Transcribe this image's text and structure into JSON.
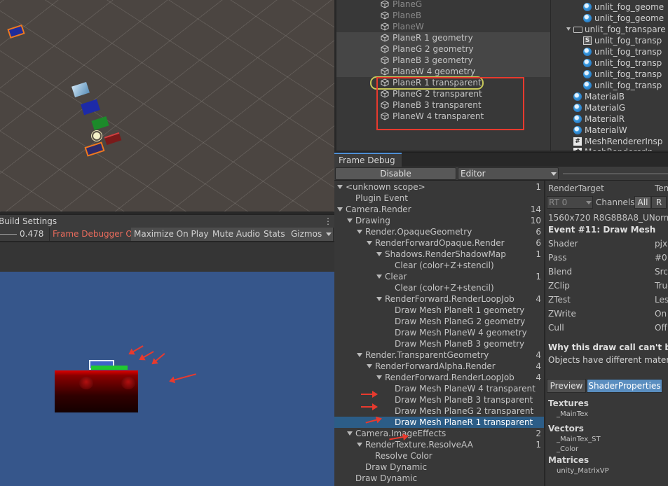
{
  "hierarchy": {
    "items": [
      {
        "label": "PlaneG"
      },
      {
        "label": "PlaneB"
      },
      {
        "label": "PlaneW"
      },
      {
        "label": "PlaneR 1 geometry"
      },
      {
        "label": "PlaneG 2 geometry"
      },
      {
        "label": "PlaneB 3 geometry"
      },
      {
        "label": "PlaneW 4 geometry"
      },
      {
        "label": "PlaneR 1 transparent"
      },
      {
        "label": "PlaneG 2 transparent"
      },
      {
        "label": "PlaneB 3 transparent"
      },
      {
        "label": "PlaneW 4 transparent"
      }
    ]
  },
  "project": {
    "items": [
      {
        "label": "unlit_fog_geome"
      },
      {
        "label": "unlit_fog_geome"
      },
      {
        "label": "unlit_fog_transpare"
      },
      {
        "label": "unlit_fog_transp"
      },
      {
        "label": "unlit_fog_transp"
      },
      {
        "label": "unlit_fog_transp"
      },
      {
        "label": "unlit_fog_transp"
      },
      {
        "label": "unlit_fog_transp"
      },
      {
        "label": "MaterialB"
      },
      {
        "label": "MaterialG"
      },
      {
        "label": "MaterialR"
      },
      {
        "label": "MaterialW"
      },
      {
        "label": "MeshRendererInsp"
      },
      {
        "label": "MeshRendererIn"
      }
    ]
  },
  "game": {
    "tab_label": "Build Settings",
    "scale_value": "0.478",
    "frame_debugger_label": "Frame Debugger On",
    "maximize_label": "Maximize On Play",
    "mute_label": "Mute Audio",
    "stats_label": "Stats",
    "gizmos_label": "Gizmos"
  },
  "frame_debug": {
    "tab_label": "Frame Debug",
    "disable_label": "Disable",
    "target_label": "Editor",
    "tree": [
      {
        "label": "<unknown scope>",
        "count": "1"
      },
      {
        "label": "Plugin Event",
        "count": ""
      },
      {
        "label": "Camera.Render",
        "count": "14"
      },
      {
        "label": "Drawing",
        "count": "10"
      },
      {
        "label": "Render.OpaqueGeometry",
        "count": "6"
      },
      {
        "label": "RenderForwardOpaque.Render",
        "count": "6"
      },
      {
        "label": "Shadows.RenderShadowMap",
        "count": "1"
      },
      {
        "label": "Clear (color+Z+stencil)",
        "count": ""
      },
      {
        "label": "Clear",
        "count": "1"
      },
      {
        "label": "Clear (color+Z+stencil)",
        "count": ""
      },
      {
        "label": "RenderForward.RenderLoopJob",
        "count": "4"
      },
      {
        "label": "Draw Mesh PlaneR 1 geometry",
        "count": ""
      },
      {
        "label": "Draw Mesh PlaneG 2 geometry",
        "count": ""
      },
      {
        "label": "Draw Mesh PlaneW 4 geometry",
        "count": ""
      },
      {
        "label": "Draw Mesh PlaneB 3 geometry",
        "count": ""
      },
      {
        "label": "Render.TransparentGeometry",
        "count": "4"
      },
      {
        "label": "RenderForwardAlpha.Render",
        "count": "4"
      },
      {
        "label": "RenderForward.RenderLoopJob",
        "count": "4"
      },
      {
        "label": "Draw Mesh PlaneW 4 transparent",
        "count": ""
      },
      {
        "label": "Draw Mesh PlaneB 3 transparent",
        "count": ""
      },
      {
        "label": "Draw Mesh PlaneG 2 transparent",
        "count": ""
      },
      {
        "label": "Draw Mesh PlaneR 1 transparent",
        "count": ""
      },
      {
        "label": "Camera.ImageEffects",
        "count": "2"
      },
      {
        "label": "RenderTexture.ResolveAA",
        "count": "1"
      },
      {
        "label": "Resolve Color",
        "count": ""
      },
      {
        "label": "Draw Dynamic",
        "count": ""
      },
      {
        "label": "Draw Dynamic",
        "count": ""
      }
    ],
    "details": {
      "render_target_label": "RenderTarget",
      "render_target_extra": "Ten",
      "rt_select": "RT 0",
      "channels_label": "Channels",
      "all_label": "All",
      "r_label": "R",
      "format": "1560x720 R8G8B8A8_UNorm",
      "event": "Event #11: Draw Mesh",
      "props": [
        {
          "label": "Shader",
          "value": "pjx"
        },
        {
          "label": "Pass",
          "value": "#0"
        },
        {
          "label": "Blend",
          "value": "Src"
        },
        {
          "label": "ZClip",
          "value": "True"
        },
        {
          "label": "ZTest",
          "value": "Les"
        },
        {
          "label": "ZWrite",
          "value": "On"
        },
        {
          "label": "Cull",
          "value": "Off"
        }
      ],
      "why_heading": "Why this draw call can't be ba",
      "why_text": "Objects have different materia",
      "preview_label": "Preview",
      "shader_props_label": "ShaderProperties",
      "textures_heading": "Textures",
      "textures_item": "_MainTex",
      "vectors_heading": "Vectors",
      "vectors_item1": "_MainTex_ST",
      "vectors_item2": "_Color",
      "matrices_heading": "Matrices",
      "matrices_item": "unity_MatrixVP"
    }
  },
  "colors": {
    "annotation_red": "#e83a2e",
    "selection_blue": "#2c5d87",
    "game_background": "#36568b",
    "highlight_yellow": "#c8c85a"
  }
}
